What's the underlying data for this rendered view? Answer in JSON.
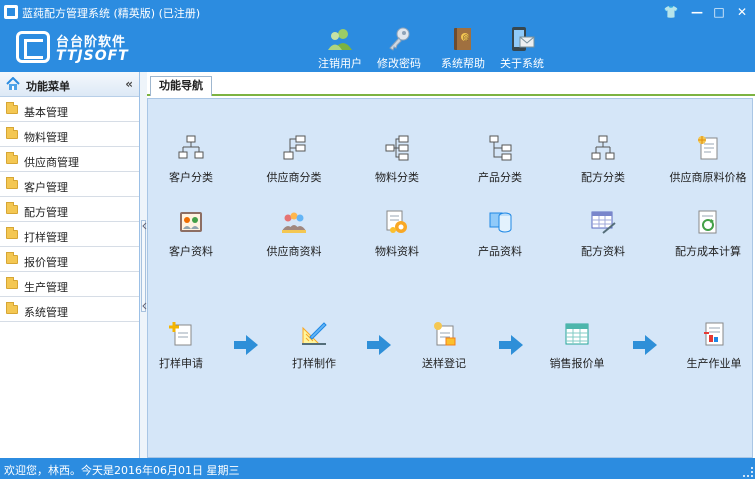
{
  "window": {
    "title": "蓝莼配方管理系统 (精英版) (已注册)",
    "controls": [
      "👕",
      "—",
      "□",
      "✕"
    ]
  },
  "logo": {
    "cn": "台台阶软件",
    "en": "TTJSOFT"
  },
  "toolbar": [
    {
      "label": "注销用户",
      "icon": "users-icon"
    },
    {
      "label": "修改密码",
      "icon": "key-icon"
    },
    {
      "label": "系统帮助",
      "icon": "help-book-icon"
    },
    {
      "label": "关于系统",
      "icon": "mail-device-icon"
    }
  ],
  "sidebar": {
    "title": "功能菜单",
    "collapse": "«",
    "items": [
      "基本管理",
      "物料管理",
      "供应商管理",
      "客户管理",
      "配方管理",
      "打样管理",
      "报价管理",
      "生产管理",
      "系统管理"
    ]
  },
  "tab": {
    "label": "功能导航"
  },
  "nav": {
    "row1": [
      {
        "label": "客户分类",
        "icon": "org-chart-icon"
      },
      {
        "label": "供应商分类",
        "icon": "org-chart-icon"
      },
      {
        "label": "物料分类",
        "icon": "org-chart-icon"
      },
      {
        "label": "产品分类",
        "icon": "org-chart-icon"
      },
      {
        "label": "配方分类",
        "icon": "org-chart-icon"
      },
      {
        "label": "供应商原料价格",
        "icon": "price-doc-icon"
      }
    ],
    "row2": [
      {
        "label": "客户资料",
        "icon": "contacts-book-icon"
      },
      {
        "label": "供应商资料",
        "icon": "people-group-icon"
      },
      {
        "label": "物料资料",
        "icon": "gear-doc-icon"
      },
      {
        "label": "产品资料",
        "icon": "database-icon"
      },
      {
        "label": "配方资料",
        "icon": "table-edit-icon"
      },
      {
        "label": "配方成本计算",
        "icon": "refresh-doc-icon"
      }
    ],
    "flow": [
      {
        "label": "打样申请",
        "icon": "add-doc-icon"
      },
      {
        "label": "打样制作",
        "icon": "ruler-icon"
      },
      {
        "label": "送样登记",
        "icon": "register-doc-icon"
      },
      {
        "label": "销售报价单",
        "icon": "table-icon"
      },
      {
        "label": "生产作业单",
        "icon": "report-doc-icon"
      }
    ]
  },
  "status": {
    "text": "欢迎您，林西。今天是2016年06月01日 星期三"
  },
  "colors": {
    "chrome": "#2c8ce0",
    "panel": "#d5e6f8",
    "arrow": "#2e8fd8",
    "tab_accent": "#7cb342"
  }
}
